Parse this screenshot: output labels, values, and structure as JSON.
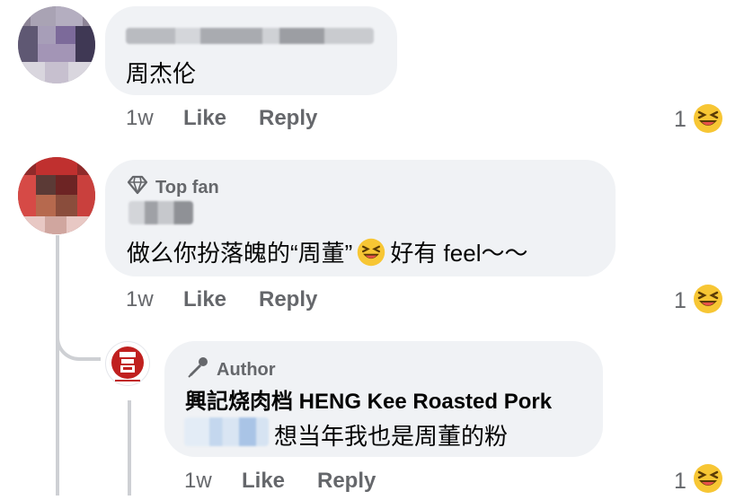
{
  "comments": [
    {
      "text": "周杰伦",
      "time": "1w",
      "like": "Like",
      "reply": "Reply",
      "reaction_count": "1",
      "reaction_icon": "laughing-emoji-icon"
    },
    {
      "badge": "Top fan",
      "badge_icon": "diamond-icon",
      "text_before": "做么你扮落魄的“周董”",
      "text_after": "好有 feel～～",
      "inline_icon": "laughing-emoji-icon",
      "time": "1w",
      "like": "Like",
      "reply": "Reply",
      "reaction_count": "1",
      "reaction_icon": "laughing-emoji-icon"
    },
    {
      "badge": "Author",
      "badge_icon": "microphone-icon",
      "author": "興記烧肉档 HENG Kee Roasted Pork",
      "text": "想当年我也是周董的粉",
      "time": "1w",
      "like": "Like",
      "reply": "Reply",
      "reaction_count": "1",
      "reaction_icon": "laughing-emoji-icon"
    }
  ],
  "colors": {
    "bubble": "#f0f2f5",
    "secondary_text": "#65676b",
    "thread_line": "#ced0d4",
    "logo_red": "#c0201f"
  }
}
